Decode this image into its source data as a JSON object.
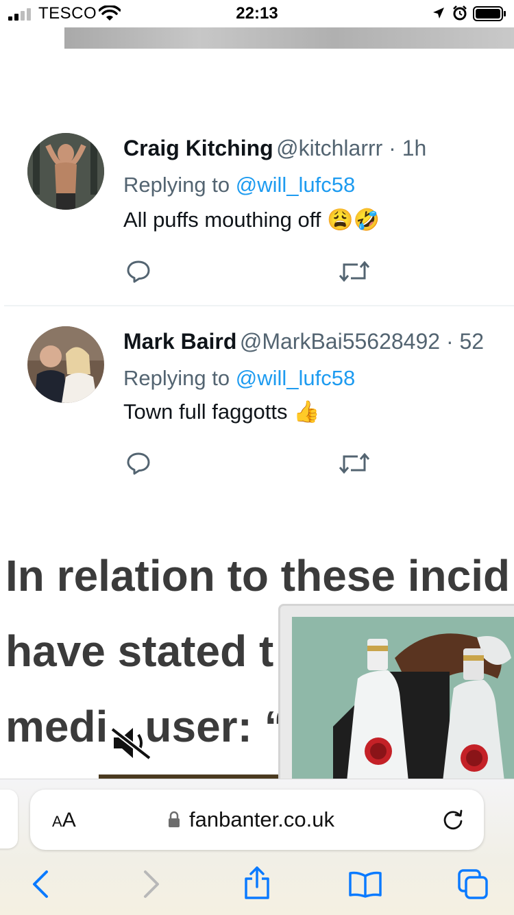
{
  "status_bar": {
    "carrier": "TESCO",
    "time": "22:13",
    "icons": [
      "signal-icon",
      "wifi-icon",
      "location-arrow-icon",
      "alarm-icon",
      "battery-icon"
    ]
  },
  "tweets": [
    {
      "name": "Craig Kitching",
      "handle": "@kitchlarrr · 1h",
      "replying_prefix": "Replying to ",
      "replying_mention": "@will_lufc58",
      "text": "All puffs mouthing off",
      "emoji": "😩🤣"
    },
    {
      "name": "Mark Baird",
      "handle": "@MarkBai55628492 · 52",
      "replying_prefix": "Replying to ",
      "replying_mention": "@will_lufc58",
      "text": "Town full faggotts",
      "emoji": "👍"
    }
  ],
  "article": {
    "lines": [
      "In relation to these incid",
      "have stated t",
      "medi",
      "user: “"
    ]
  },
  "browser": {
    "text_size_label_small": "A",
    "text_size_label_large": "A",
    "url": "fanbanter.co.uk"
  },
  "colors": {
    "link": "#1d9bf0",
    "muted": "#536471",
    "safari_blue": "#0a7aff"
  }
}
